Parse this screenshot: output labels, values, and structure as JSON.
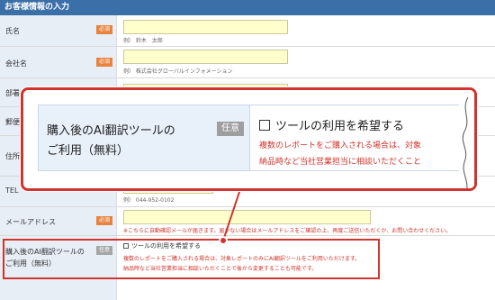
{
  "header": {
    "title": "お客様情報の入力"
  },
  "badges": {
    "required": "必須",
    "optional": "任意"
  },
  "rows": {
    "name": {
      "label": "氏名",
      "example": "例） 鈴木　太郎"
    },
    "company": {
      "label": "会社名",
      "example": "例） 株式会社グローバルインフォメーション"
    },
    "department": {
      "label": "部署"
    },
    "postal": {
      "label": "郵便番号"
    },
    "address": {
      "label": "住所"
    },
    "tel": {
      "label": "TEL",
      "example": "例） 044-952-0102"
    },
    "email": {
      "label": "メールアドレス",
      "note": "※こちらに自動確認メールが届きます。届かない場合はメールアドレスをご確認の上、再度ご送信いただくか、お問い合わせください。"
    },
    "ai": {
      "label_line1": "購入後のAI翻訳ツールの",
      "label_line2": "ご利用（無料）",
      "checkbox_label": "ツールの利用を希望する",
      "note_line1": "複数のレポートをご購入される場合は、対象レポートのみにAI翻訳ツールをご利用いただけます。",
      "note_line2": "納品時など当社営業担当に相談いただくことで後から変更することも可能です。"
    }
  },
  "zoom": {
    "label_line1": "購入後のAI翻訳ツールの",
    "label_line2": "ご利用（無料）",
    "badge": "任意",
    "checkbox_label": "ツールの利用を希望する",
    "note_line1": "複数のレポートをご購入される場合は、対象",
    "note_line2": "納品時など当社営業担当に相談いただくこと"
  },
  "colors": {
    "header": "#3b6fa8",
    "accent": "#d0342c",
    "required_badge": "#e8823c",
    "field": "#ffffcc"
  }
}
